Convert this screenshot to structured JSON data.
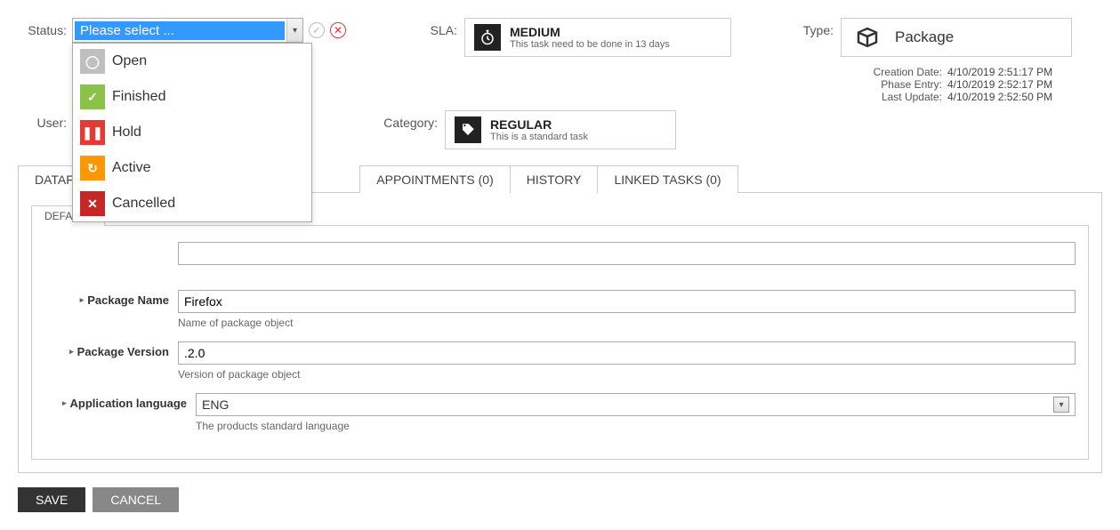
{
  "status": {
    "label": "Status:",
    "placeholder": "Please select ...",
    "options": [
      {
        "label": "Open",
        "color": "c-gray",
        "icon": "◯"
      },
      {
        "label": "Finished",
        "color": "c-green",
        "icon": "✓"
      },
      {
        "label": "Hold",
        "color": "c-red",
        "icon": "❚❚"
      },
      {
        "label": "Active",
        "color": "c-orange",
        "icon": "↻"
      },
      {
        "label": "Cancelled",
        "color": "c-darkred",
        "icon": "✕"
      }
    ]
  },
  "user": {
    "label": "User:"
  },
  "sla": {
    "label": "SLA:",
    "title": "MEDIUM",
    "sub": "This task need to be done in 13 days"
  },
  "category": {
    "label": "Category:",
    "title": "REGULAR",
    "sub": "This is a standard task"
  },
  "type": {
    "label": "Type:",
    "title": "Package"
  },
  "meta": {
    "creation": {
      "k": "Creation Date:",
      "v": "4/10/2019 2:51:17 PM"
    },
    "phase": {
      "k": "Phase Entry:",
      "v": "4/10/2019 2:52:17 PM"
    },
    "update": {
      "k": "Last Update:",
      "v": "4/10/2019 2:52:50 PM"
    }
  },
  "tabs": {
    "datafields": "DATAFIELDS",
    "appointments": "APPOINTMENTS (0)",
    "history": "HISTORY",
    "linked": "LINKED TASKS (0)"
  },
  "subtab": "DEFAULT",
  "form": {
    "pkgName": {
      "label": "Package Name",
      "value": "Firefox",
      "help": "Name of package object"
    },
    "pkgVer": {
      "label": "Package Version",
      "value": ".2.0",
      "help": "Version of package object"
    },
    "appLang": {
      "label": "Application language",
      "value": "ENG",
      "help": "The products standard language"
    }
  },
  "buttons": {
    "save": "SAVE",
    "cancel": "CANCEL"
  }
}
